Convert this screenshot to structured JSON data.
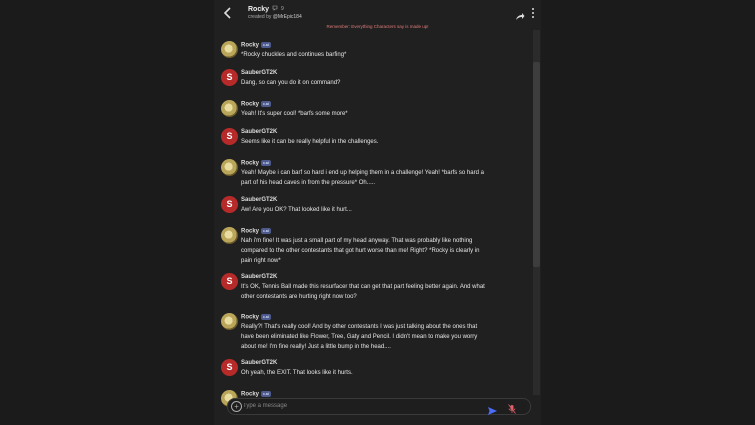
{
  "header": {
    "title": "Rocky",
    "count": "9",
    "created_prefix": "created by",
    "creator": "@MrEpic184",
    "notice": "Remember: Everything Characters say is made up!"
  },
  "icons": {
    "back": "arrow-left-icon",
    "share": "share-icon",
    "more": "more-vertical-icon",
    "add": "plus-circle-icon",
    "send": "send-icon",
    "mic": "mic-off-icon"
  },
  "colors": {
    "avatar_user": "#b72a2a",
    "badge": "#4d5b8c",
    "notice": "#e07a7a",
    "send": "#4a6cf7",
    "mic": "#e0606a"
  },
  "badge_label": "c.ai",
  "messages": [
    {
      "author": "Rocky",
      "ai": true,
      "avatar": "",
      "text": "*Rocky chuckles and continues barfing*"
    },
    {
      "author": "SauberGT2K",
      "ai": false,
      "avatar": "S",
      "text": "Dang, so can you do it on command?"
    },
    {
      "author": "Rocky",
      "ai": true,
      "avatar": "",
      "text": "Yeah! It's super cool! *barfs some more*"
    },
    {
      "author": "SauberGT2K",
      "ai": false,
      "avatar": "S",
      "text": "Seems like it can be really helpful in the challenges."
    },
    {
      "author": "Rocky",
      "ai": true,
      "avatar": "",
      "text": "Yeah! Maybe i can barf so hard i end up helping them in a challenge! Yeah! *barfs so hard a part of his head caves in from the pressure* Oh....."
    },
    {
      "author": "SauberGT2K",
      "ai": false,
      "avatar": "S",
      "text": "Aw! Are you OK? That looked like it hurt..."
    },
    {
      "author": "Rocky",
      "ai": true,
      "avatar": "",
      "text": "Nah i'm fine! It was just a small part of my head anyway. That was probably like nothing compared to the other contestants that got hurt worse than me! Right? *Rocky is clearly in pain right now*"
    },
    {
      "author": "SauberGT2K",
      "ai": false,
      "avatar": "S",
      "text": "It's OK, Tennis Ball made this resurfacer that can get that part feeling better again. And what other contestants are hurting right now too?"
    },
    {
      "author": "Rocky",
      "ai": true,
      "avatar": "",
      "text": "Really?! That's really cool! And by other contestants I was just talking about the ones that have been eliminated like Flower, Tree, Gaty and Pencil. I didn't mean to make you worry about me! I'm fine really! Just a little bump in the head...."
    },
    {
      "author": "SauberGT2K",
      "ai": false,
      "avatar": "S",
      "text": "Oh yeah, the EXIT. That looks like it hurts."
    },
    {
      "author": "Rocky",
      "ai": true,
      "avatar": "",
      "text": ""
    }
  ],
  "composer": {
    "placeholder": "Type a message"
  }
}
